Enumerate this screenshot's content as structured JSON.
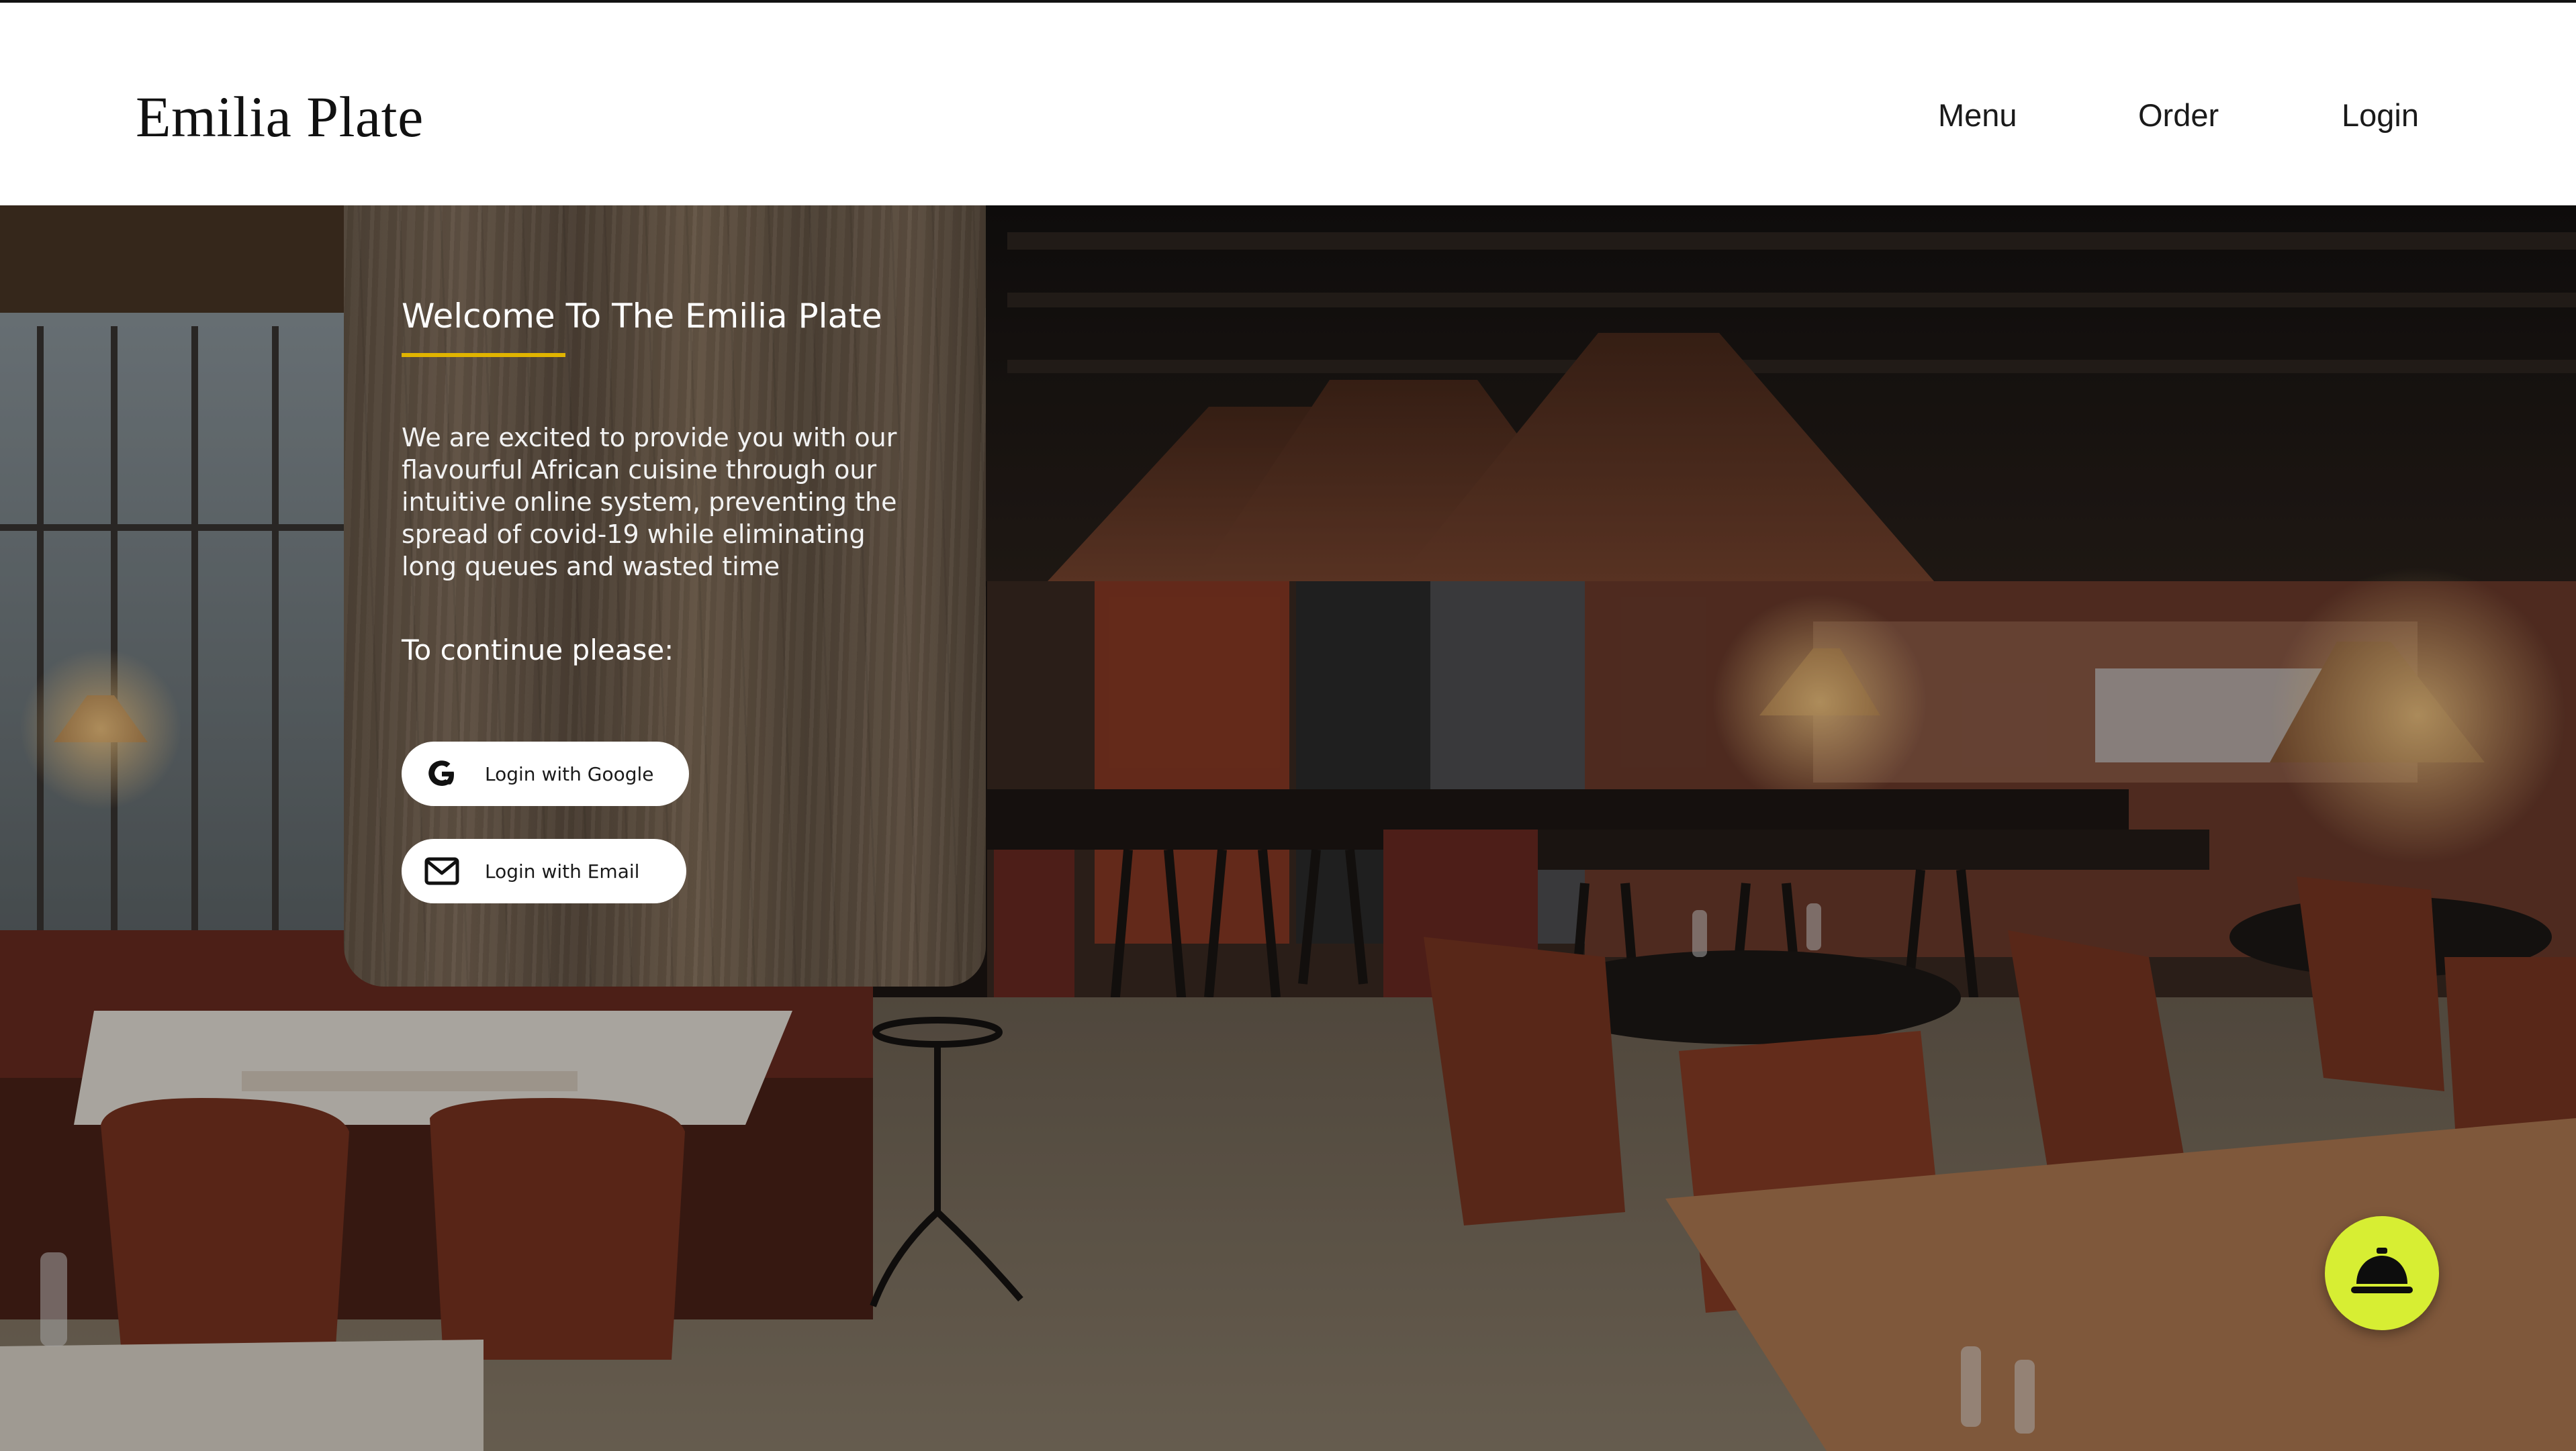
{
  "header": {
    "brand": "Emilia Plate",
    "nav": {
      "menu": "Menu",
      "order": "Order",
      "login": "Login"
    }
  },
  "welcome_card": {
    "title": "Welcome To The Emilia Plate",
    "accent_color": "#e0b400",
    "description": "We are excited to provide you with our flavourful African cuisine through our intuitive online system, preventing the spread of covid-19 while eliminating long queues and wasted time",
    "continue_label": "To continue please:",
    "buttons": {
      "google": "Login with Google",
      "email": "Login with Email"
    }
  },
  "floating_action": {
    "icon": "service-bell-icon",
    "color": "#d7ee33"
  },
  "icons": {
    "google": "google-g-icon",
    "email": "envelope-icon"
  }
}
